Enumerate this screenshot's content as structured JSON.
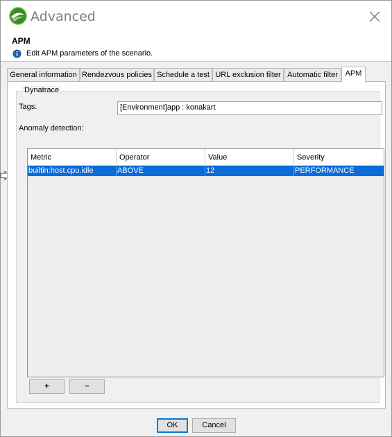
{
  "window": {
    "title": "Advanced"
  },
  "header": {
    "title": "APM",
    "description": "Edit APM parameters of the scenario."
  },
  "tabs": [
    {
      "label": "General information"
    },
    {
      "label": "Rendezvous policies"
    },
    {
      "label": "Schedule a test"
    },
    {
      "label": "URL exclusion filter"
    },
    {
      "label": "Automatic filter"
    },
    {
      "label": "APM"
    }
  ],
  "active_tab": "APM",
  "dynatrace": {
    "group_title": "Dynatrace",
    "tags_label": "Tags:",
    "tags_value": "[Environment]app : konakart",
    "anomaly_label": "Anomaly detection:"
  },
  "anomaly_table": {
    "columns": [
      "Metric",
      "Operator",
      "Value",
      "Severity"
    ],
    "rows": [
      {
        "metric": "builtin:host.cpu.idle",
        "operator": "ABOVE",
        "value": "12",
        "severity": "PERFORMANCE",
        "selected": true
      }
    ]
  },
  "table_buttons": {
    "add_label": "+",
    "remove_label": "−"
  },
  "footer": {
    "ok_label": "OK",
    "cancel_label": "Cancel"
  },
  "icons": {
    "logo": "app-logo-icon",
    "close": "close-icon",
    "info": "info-icon",
    "pointer": "arrow-pointer-icon"
  },
  "colors": {
    "selection": "#0a6cd8",
    "accent": "#0078d7"
  }
}
